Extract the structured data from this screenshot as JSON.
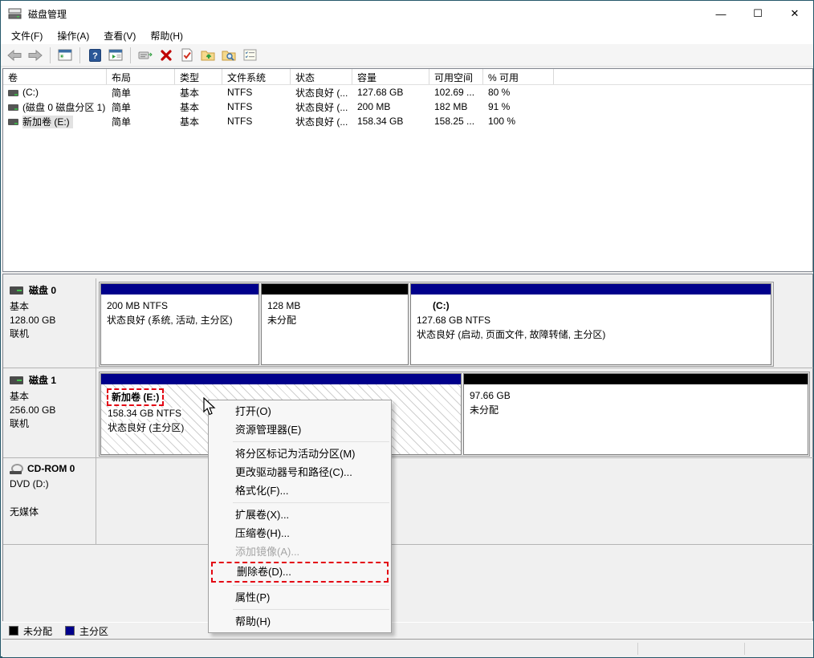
{
  "window": {
    "title": "磁盘管理",
    "minimize": "—",
    "maximize": "☐",
    "close": "✕"
  },
  "menu_bar": {
    "items": [
      "文件(F)",
      "操作(A)",
      "查看(V)",
      "帮助(H)"
    ]
  },
  "toolbar": {
    "icons": [
      "back-arrow",
      "forward-arrow",
      "console-tree",
      "help",
      "action-pane",
      "status-popup",
      "delete-x",
      "validate-doc",
      "folder-up",
      "folder-search",
      "task-list"
    ]
  },
  "volume_table": {
    "columns": [
      "卷",
      "布局",
      "类型",
      "文件系统",
      "状态",
      "容量",
      "可用空间",
      "% 可用"
    ],
    "rows": [
      {
        "volume": "(C:)",
        "layout": "简单",
        "type": "基本",
        "fs": "NTFS",
        "status": "状态良好 (...",
        "capacity": "127.68 GB",
        "free": "102.69 ...",
        "pct": "80 %"
      },
      {
        "volume": "(磁盘 0 磁盘分区 1)",
        "layout": "简单",
        "type": "基本",
        "fs": "NTFS",
        "status": "状态良好 (...",
        "capacity": "200 MB",
        "free": "182 MB",
        "pct": "91 %"
      },
      {
        "volume": "新加卷 (E:)",
        "layout": "简单",
        "type": "基本",
        "fs": "NTFS",
        "status": "状态良好 (...",
        "capacity": "158.34 GB",
        "free": "158.25 ...",
        "pct": "100 %"
      }
    ]
  },
  "disks": [
    {
      "name": "磁盘 0",
      "type": "基本",
      "size": "128.00 GB",
      "status": "联机",
      "partitions": [
        {
          "name": "",
          "line1": "200 MB NTFS",
          "line2": "状态良好 (系统, 活动, 主分区)",
          "bar": "#00008b"
        },
        {
          "name": "",
          "line1": "128 MB",
          "line2": "未分配",
          "bar": "#000000"
        },
        {
          "name": "(C:)",
          "line1": "127.68 GB NTFS",
          "line2": "状态良好 (启动, 页面文件, 故障转储, 主分区)",
          "bar": "#00008b"
        }
      ]
    },
    {
      "name": "磁盘 1",
      "type": "基本",
      "size": "256.00 GB",
      "status": "联机",
      "partitions": [
        {
          "name": "新加卷  (E:)",
          "line1": "158.34 GB NTFS",
          "line2": "状态良好 (主分区)",
          "bar": "#00008b"
        },
        {
          "name": "",
          "line1": "97.66 GB",
          "line2": "未分配",
          "bar": "#000000"
        }
      ]
    }
  ],
  "cdrom": {
    "name": "CD-ROM 0",
    "line1": "DVD (D:)",
    "line2": "无媒体"
  },
  "legend": [
    {
      "label": "未分配",
      "color": "#000000"
    },
    {
      "label": "主分区",
      "color": "#00008b"
    }
  ],
  "context_menu": {
    "items": [
      {
        "label": "打开(O)"
      },
      {
        "label": "资源管理器(E)"
      },
      {
        "label": "将分区标记为活动分区(M)"
      },
      {
        "label": "更改驱动器号和路径(C)..."
      },
      {
        "label": "格式化(F)..."
      },
      {
        "label": "扩展卷(X)..."
      },
      {
        "label": "压缩卷(H)..."
      },
      {
        "label": "添加镜像(A)...",
        "disabled": true
      },
      {
        "label": "删除卷(D)...",
        "highlighted": true
      },
      {
        "label": "属性(P)"
      },
      {
        "label": "帮助(H)"
      }
    ]
  }
}
